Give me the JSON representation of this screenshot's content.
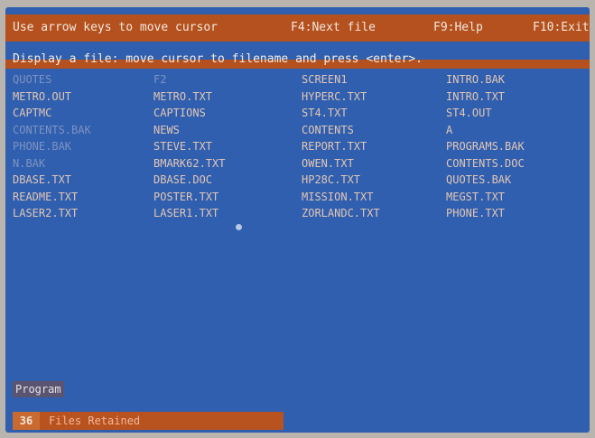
{
  "top_bar": {
    "hint": "Use arrow keys to move cursor",
    "f4": "F4:Next file",
    "f9": "F9:Help",
    "f10": "F10:Exit"
  },
  "title_row": "Display a file: move cursor to filename and press <enter>.",
  "files": [
    [
      "QUOTES",
      "F2",
      "SCREEN1",
      "INTRO.BAK"
    ],
    [
      "METRO.OUT",
      "METRO.TXT",
      "HYPERC.TXT",
      "INTRO.TXT"
    ],
    [
      "CAPTMC",
      "CAPTIONS",
      "ST4.TXT",
      "ST4.OUT"
    ],
    [
      "CONTENTS.BAK",
      "NEWS",
      "CONTENTS",
      "A"
    ],
    [
      "PHONE.BAK",
      "STEVE.TXT",
      "REPORT.TXT",
      "PROGRAMS.BAK"
    ],
    [
      "N.BAK",
      "BMARK62.TXT",
      "OWEN.TXT",
      "CONTENTS.DOC"
    ],
    [
      "DBASE.TXT",
      "DBASE.DOC",
      "HP28C.TXT",
      "QUOTES.BAK"
    ],
    [
      "README.TXT",
      "POSTER.TXT",
      "MISSION.TXT",
      "MEGST.TXT"
    ],
    [
      "LASER2.TXT",
      "LASER1.TXT",
      "ZORLANDC.TXT",
      "PHONE.TXT"
    ]
  ],
  "program_tag": "Program",
  "status": {
    "count": "36",
    "label": "Files Retained"
  }
}
